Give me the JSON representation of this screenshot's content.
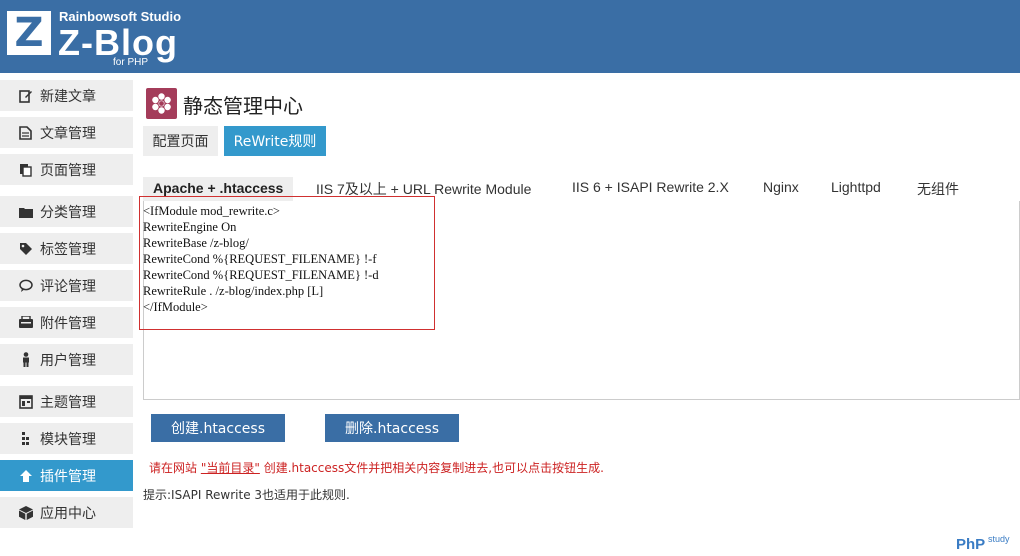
{
  "header": {
    "logo_letter": "Z",
    "studio": "Rainbowsoft Studio",
    "brand": "Z-Blog",
    "for_php": "for PHP"
  },
  "sidebar": {
    "items": [
      {
        "label": "新建文章",
        "icon": "edit-icon"
      },
      {
        "label": "文章管理",
        "icon": "document-icon"
      },
      {
        "label": "页面管理",
        "icon": "pages-icon"
      },
      {
        "label": "分类管理",
        "icon": "folder-icon"
      },
      {
        "label": "标签管理",
        "icon": "tag-icon"
      },
      {
        "label": "评论管理",
        "icon": "comment-icon"
      },
      {
        "label": "附件管理",
        "icon": "attachment-icon"
      },
      {
        "label": "用户管理",
        "icon": "user-icon"
      },
      {
        "label": "主题管理",
        "icon": "theme-icon"
      },
      {
        "label": "模块管理",
        "icon": "module-icon"
      },
      {
        "label": "插件管理",
        "icon": "plugin-icon",
        "active": true
      },
      {
        "label": "应用中心",
        "icon": "app-center-icon"
      }
    ]
  },
  "main": {
    "title": "静态管理中心",
    "subtabs": [
      {
        "label": "配置页面"
      },
      {
        "label": "ReWrite规则",
        "active": true
      }
    ],
    "tabs": [
      {
        "label": "Apache + .htaccess",
        "active": true
      },
      {
        "label": "IIS 7及以上 + URL Rewrite Module"
      },
      {
        "label": "IIS 6 + ISAPI Rewrite 2.X"
      },
      {
        "label": "Nginx"
      },
      {
        "label": "Lighttpd"
      },
      {
        "label": "无组件"
      }
    ],
    "code_lines": [
      "<IfModule mod_rewrite.c>",
      "RewriteEngine On",
      "RewriteBase /z-blog/",
      "RewriteCond %{REQUEST_FILENAME} !-f",
      "RewriteCond %{REQUEST_FILENAME} !-d",
      "RewriteRule . /z-blog/index.php [L]",
      "</IfModule>"
    ],
    "buttons": {
      "create": "创建.htaccess",
      "delete": "删除.htaccess"
    },
    "note": {
      "before": "请在网站 ",
      "link": "\"当前目录\"",
      "after": " 创建.htaccess文件并把相关内容复制进去,也可以点击按钮生成."
    },
    "tip": "提示:ISAPI Rewrite 3也适用于此规则."
  },
  "watermark": {
    "main": "PhP",
    "sub": "study"
  },
  "colors": {
    "header": "#3a6ea5",
    "accent": "#3399cc",
    "button": "#3a6ea5",
    "warning": "#cc2222",
    "highlight_border": "#d03030",
    "title_icon": "#a43c5a"
  }
}
